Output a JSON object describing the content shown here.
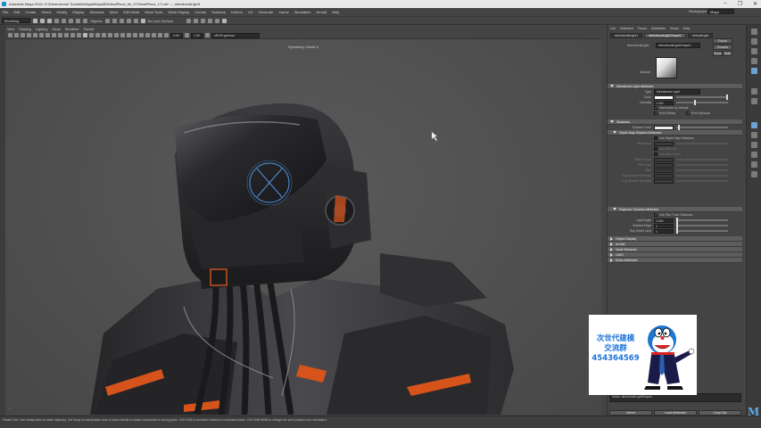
{
  "window": {
    "title": "Autodesk Maya 2016: D:\\Dimensional Tutorials\\Maya\\Maya3D\\HeadPiece_fin_07\\HeadPiece_17.mb* --- directionalLight1",
    "controls": [
      "–",
      "❐",
      "✕"
    ]
  },
  "menubar": {
    "items": [
      "File",
      "Edit",
      "Create",
      "Select",
      "Modify",
      "Display",
      "Windows",
      "Mesh",
      "Edit Mesh",
      "Mesh Tools",
      "Mesh Display",
      "Curves",
      "Surfaces",
      "Deform",
      "UV",
      "Generate",
      "Cache",
      "Simulation",
      "Arnold",
      "Help"
    ],
    "workspace_label": "Workspace:",
    "workspace_value": "Maya"
  },
  "statusline": {
    "mode": "Modeling",
    "objects_label": "Objects",
    "live_surface": "No Live Surface"
  },
  "panel": {
    "menus": [
      "View",
      "Shading",
      "Lighting",
      "Show",
      "Renderer",
      "Panels"
    ],
    "field1": "0.00",
    "field2": "1.00",
    "color_space": "sRGB gamma",
    "camera_label": "Symmetry: World X"
  },
  "viewport": {
    "axis_label": "z"
  },
  "attribute_editor": {
    "top_tabs": [
      "List",
      "Selected",
      "Focus",
      "Attributes",
      "Show",
      "Help"
    ],
    "node_tabs": [
      "directionalLight1",
      "directionalLightShape1",
      "defaultLight"
    ],
    "focus_btn": "Focus",
    "presets_btn": "Presets",
    "show_btn": "Show",
    "hide_btn": "Hide",
    "node_label": "directionalLight:",
    "node_value": "directionalLightShape1",
    "sample_label": "Sample",
    "sections": {
      "attrs": "Directional Light Attributes",
      "shadows": "Shadows",
      "depth_map": "Depth Map Shadow Attributes",
      "raytrace": "Raytrace Shadow Attributes",
      "object_display": "Object Display",
      "arnold": "Arnold",
      "node_behavior": "Node Behavior",
      "uuid": "UUID",
      "extra": "Extra Attributes"
    },
    "type_label": "Type",
    "type_value": "Directional Light",
    "color_label": "Color",
    "intensity_label": "Intensity",
    "intensity_value": "1.000",
    "illum_default": "Illuminates by Default",
    "emit_diffuse": "Emit Diffuse",
    "emit_specular": "Emit Specular",
    "shadow_color_label": "Shadow Color",
    "use_depth_map": "Use Depth Map Shadows",
    "resolution_label": "Resolution",
    "use_mid_dist": "Use Mid Dist",
    "use_auto_focus": "Use Auto Focus",
    "width_focus_label": "Width Focus",
    "filter_size_label": "Filter Size",
    "bias_label": "Bias",
    "fog_shadow_label": "Fog Shadow Intensity",
    "fog_samples_label": "Fog Shadow Samples",
    "light_radius_label": "Light Angle",
    "shadow_rays_label": "Shadow Rays",
    "ray_depth_label": "Ray Depth Limit",
    "use_ray_trace": "Use Ray Trace Shadows",
    "light_angle_value": "0.000",
    "shadow_rays_value": "1",
    "ray_depth_value": "1",
    "notes_label": "Notes: directionalLightShape1",
    "select_btn": "Select",
    "load_btn": "Load Attributes",
    "copy_btn": "Copy Tab"
  },
  "helpline": {
    "text": "Rotate Tool: Use manipulator to rotate object(s). Ctrl+drag on manipulator axis or plane handle to rotate constrained or along plane. Ctrl+LMB to constrain rotation to computed plane. Ctrl+Shift+MMB to change the pivot position and orientation."
  },
  "watermark": {
    "line1": "次世代建模",
    "line2": "交流群",
    "line3": "454364569"
  },
  "logo": "M"
}
